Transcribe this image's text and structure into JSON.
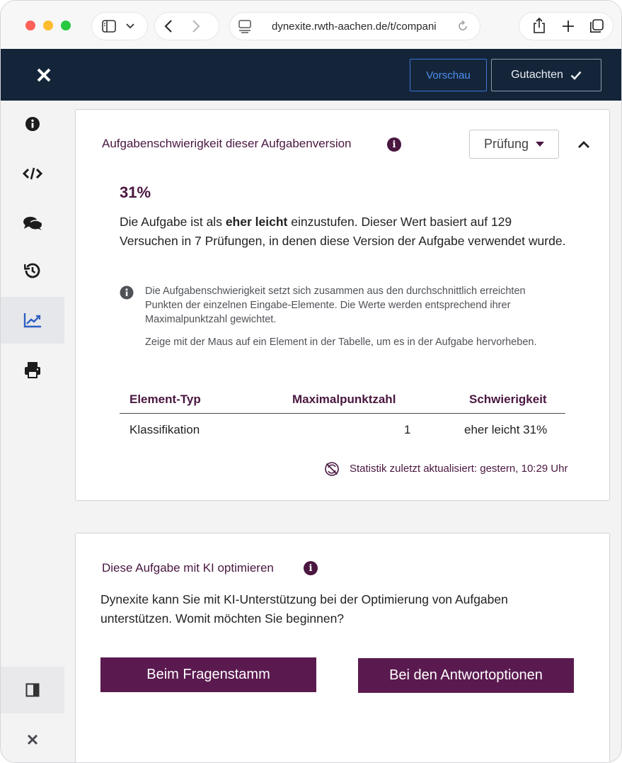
{
  "browser": {
    "url": "dynexite.rwth-aachen.de/t/compani"
  },
  "header": {
    "preview_label": "Vorschau",
    "review_label": "Gutachten",
    "accent_color": "#4d8ff0",
    "bar_color": "#14253a"
  },
  "sidebar": {
    "items": [
      {
        "icon": "info-icon"
      },
      {
        "icon": "code-icon"
      },
      {
        "icon": "comments-icon"
      },
      {
        "icon": "history-icon"
      },
      {
        "icon": "chart-line-icon",
        "active": true
      },
      {
        "icon": "print-icon"
      }
    ],
    "bottom": [
      {
        "icon": "panel-toggle-icon"
      },
      {
        "icon": "close-icon"
      }
    ]
  },
  "difficulty": {
    "title": "Aufgabenschwierigkeit dieser Aufgabenversion",
    "scope_label": "Prüfung",
    "percent": "31%",
    "desc_before": "Die Aufgabe ist als ",
    "desc_bold": "eher leicht",
    "desc_after": " einzustufen. Dieser Wert basiert auf 129 Versuchen in 7 Prüfungen, in denen diese Version der Aufgabe verwendet wurde.",
    "note_1": "Die Aufgabenschwierigkeit setzt sich zusammen aus den durchschnittlich erreichten Punkten der einzelnen Eingabe-Elemente. Die Werte werden entsprechend ihrer Maximalpunktzahl gewichtet.",
    "note_2": "Zeige mit der Maus auf ein Element in der Tabelle, um es in der Aufgabe hervorheben.",
    "table": {
      "headers": [
        "Element-Typ",
        "Maximalpunktzahl",
        "Schwierigkeit"
      ],
      "rows": [
        [
          "Klassifikation",
          "1",
          "eher leicht 31%"
        ]
      ]
    },
    "updated": "Statistik zuletzt aktualisiert: gestern, 10:29 Uhr",
    "brand_color": "#4a1740"
  },
  "ai": {
    "title": "Diese Aufgabe mit KI optimieren",
    "desc": "Dynexite kann Sie mit KI-Unterstützung bei der Optimierung von Aufgaben unterstützen. Womit möchten Sie beginnen?",
    "btn_stem": "Beim Fragenstamm",
    "btn_options": "Bei den Antwortoptionen",
    "button_color": "#5a1a4f"
  }
}
